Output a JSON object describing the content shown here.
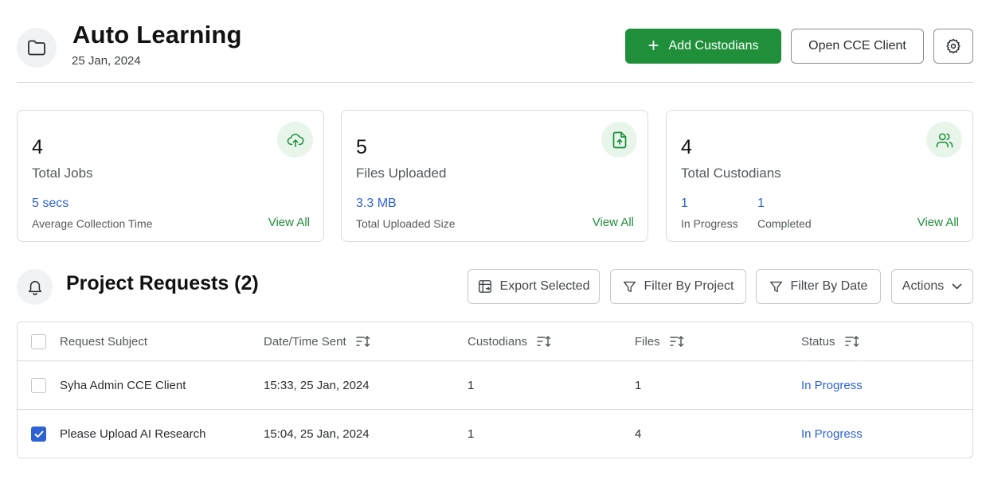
{
  "header": {
    "title": "Auto Learning",
    "date": "25 Jan, 2024",
    "add_button_label": "Add Custodians",
    "open_client_label": "Open CCE Client"
  },
  "cards": [
    {
      "value": "4",
      "label": "Total Jobs",
      "metric": "5 secs",
      "metric_label": "Average Collection Time",
      "link": "View All",
      "icon": "cloud-upload-icon"
    },
    {
      "value": "5",
      "label": "Files Uploaded",
      "metric": "3.3 MB",
      "metric_label": "Total Uploaded Size",
      "link": "View All",
      "icon": "file-upload-icon"
    },
    {
      "value": "4",
      "label": "Total Custodians",
      "metric_a": "1",
      "metric_a_label": "In Progress",
      "metric_b": "1",
      "metric_b_label": "Completed",
      "link": "View All",
      "icon": "users-icon"
    }
  ],
  "requests": {
    "title": "Project Requests (2)",
    "export_label": "Export Selected",
    "filter_project_label": "Filter By Project",
    "filter_date_label": "Filter By Date",
    "actions_label": "Actions",
    "columns": [
      "Request Subject",
      "Date/Time Sent",
      "Custodians",
      "Files",
      "Status"
    ],
    "rows": [
      {
        "subject": "Syha Admin CCE Client",
        "sent": "15:33, 25 Jan, 2024",
        "custodians": "1",
        "files": "1",
        "status": "In Progress",
        "checked": false
      },
      {
        "subject": "Please Upload AI Research",
        "sent": "15:04, 25 Jan, 2024",
        "custodians": "1",
        "files": "4",
        "status": "In Progress",
        "checked": true
      }
    ]
  },
  "colors": {
    "primary_green": "#1f8f3a",
    "link_blue": "#2d62d6",
    "icon_bg_green": "#e7f5ea"
  }
}
